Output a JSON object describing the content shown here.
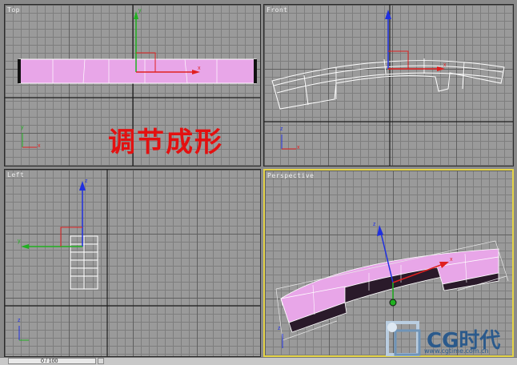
{
  "viewports": {
    "top": {
      "label": "Top"
    },
    "front": {
      "label": "Front"
    },
    "left": {
      "label": "Left"
    },
    "perspective": {
      "label": "Perspective"
    }
  },
  "overlay_text": "调节成形",
  "axis_labels": {
    "x": "x",
    "y": "y",
    "z": "z"
  },
  "watermark": {
    "brand": "CG时代",
    "url": "www.cgtime.com.cn"
  },
  "statusbar": {
    "value": "0 / 100"
  },
  "colors": {
    "active_border": "#e5d447",
    "mesh_fill": "#e8a6e8",
    "overlay_red": "#e41010",
    "axis_x": "#e02020",
    "axis_y": "#20b020",
    "axis_z": "#2030e0"
  }
}
